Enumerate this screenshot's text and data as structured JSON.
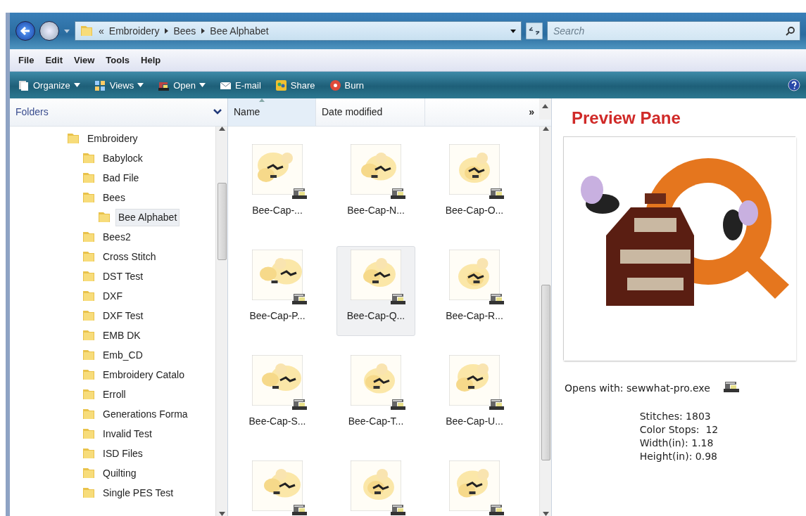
{
  "address_bar": {
    "overflow": "«",
    "path": [
      "Embroidery",
      "Bees",
      "Bee Alphabet"
    ]
  },
  "search": {
    "placeholder": "Search"
  },
  "menu": [
    "File",
    "Edit",
    "View",
    "Tools",
    "Help"
  ],
  "toolbar": [
    {
      "label": "Organize",
      "dropdown": true
    },
    {
      "label": "Views",
      "dropdown": true
    },
    {
      "label": "Open",
      "dropdown": true
    },
    {
      "label": "E-mail",
      "dropdown": false
    },
    {
      "label": "Share",
      "dropdown": false
    },
    {
      "label": "Burn",
      "dropdown": false
    }
  ],
  "folders_pane": {
    "title": "Folders",
    "tree": [
      {
        "label": "Embroidery",
        "selected": false,
        "children": [
          {
            "label": "Babylock",
            "selected": false
          },
          {
            "label": "Bad File",
            "selected": false
          },
          {
            "label": "Bees",
            "selected": false,
            "children": [
              {
                "label": "Bee Alphabet",
                "selected": true
              }
            ]
          },
          {
            "label": "Bees2",
            "selected": false
          },
          {
            "label": "Cross Stitch",
            "selected": false
          },
          {
            "label": "DST Test",
            "selected": false
          },
          {
            "label": "DXF",
            "selected": false
          },
          {
            "label": "DXF Test",
            "selected": false
          },
          {
            "label": "EMB DK",
            "selected": false
          },
          {
            "label": "Emb_CD",
            "selected": false
          },
          {
            "label": "Embroidery Catalo",
            "selected": false
          },
          {
            "label": "Erroll",
            "selected": false
          },
          {
            "label": "Generations Forma",
            "selected": false
          },
          {
            "label": "Invalid Test",
            "selected": false
          },
          {
            "label": "ISD Files",
            "selected": false
          },
          {
            "label": "Quilting",
            "selected": false
          },
          {
            "label": "Single PES Test",
            "selected": false
          }
        ]
      }
    ]
  },
  "file_list": {
    "columns": [
      {
        "label": "Name",
        "sorted": true
      },
      {
        "label": "Date modified",
        "sorted": false
      }
    ],
    "more": "»",
    "items": [
      {
        "name": "Bee-Cap-...",
        "selected": false
      },
      {
        "name": "Bee-Cap-N...",
        "selected": false
      },
      {
        "name": "Bee-Cap-O...",
        "selected": false
      },
      {
        "name": "Bee-Cap-P...",
        "selected": false
      },
      {
        "name": "Bee-Cap-Q...",
        "selected": true
      },
      {
        "name": "Bee-Cap-R...",
        "selected": false
      },
      {
        "name": "Bee-Cap-S...",
        "selected": false
      },
      {
        "name": "Bee-Cap-T...",
        "selected": false
      },
      {
        "name": "Bee-Cap-U...",
        "selected": false
      },
      {
        "selected": false
      },
      {
        "selected": false
      },
      {
        "selected": false
      }
    ]
  },
  "preview": {
    "title": "Preview Pane",
    "opens_with": "Opens with: sewwhat-pro.exe",
    "stats": [
      "Stitches: 1803",
      "Color Stops:  12",
      "Width(in): 1.18",
      "Height(in): 0.98"
    ]
  }
}
